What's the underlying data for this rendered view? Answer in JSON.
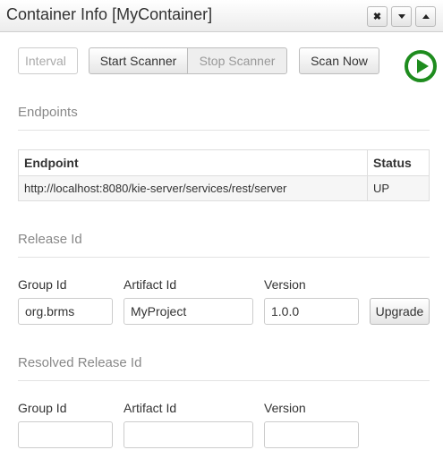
{
  "window": {
    "title": "Container Info [MyContainer]",
    "close_glyph": "✖",
    "collapse_icon": "caret-down-icon",
    "maximize_icon": "caret-up-icon"
  },
  "scanner": {
    "interval_placeholder": "Interval",
    "start_label": "Start Scanner",
    "stop_label": "Stop Scanner",
    "scan_now_label": "Scan Now",
    "play_icon": "play-circle-icon",
    "play_color": "#1e8c1e"
  },
  "endpoints": {
    "heading": "Endpoints",
    "columns": [
      "Endpoint",
      "Status"
    ],
    "rows": [
      {
        "endpoint": "http://localhost:8080/kie-server/services/rest/server",
        "status": "UP"
      }
    ]
  },
  "release": {
    "heading": "Release Id",
    "group_label": "Group Id",
    "artifact_label": "Artifact Id",
    "version_label": "Version",
    "group_value": "org.brms",
    "artifact_value": "MyProject",
    "version_value": "1.0.0",
    "upgrade_label": "Upgrade"
  },
  "resolved": {
    "heading": "Resolved Release Id",
    "group_label": "Group Id",
    "artifact_label": "Artifact Id",
    "version_label": "Version",
    "group_value": "",
    "artifact_value": "",
    "version_value": ""
  }
}
